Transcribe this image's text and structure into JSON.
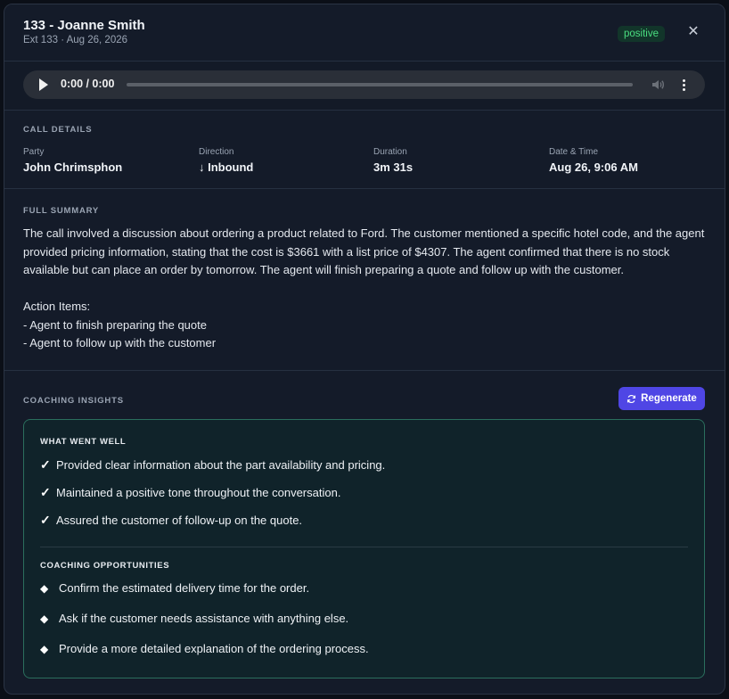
{
  "header": {
    "title": "133 - Joanne Smith",
    "subtitle": "Ext 133 · Aug 26, 2026",
    "sentiment": "positive",
    "close_glyph": "✕"
  },
  "audio": {
    "time": "0:00 / 0:00"
  },
  "details": {
    "label": "Call Details",
    "party_label": "Party",
    "party": "John Chrimsphon",
    "direction_label": "Direction",
    "direction": "↓ Inbound",
    "duration_label": "Duration",
    "duration": "3m 31s",
    "datetime_label": "Date & Time",
    "datetime": "Aug 26, 9:06 AM"
  },
  "summary": {
    "label": "Full Summary",
    "text": "The call involved a discussion about ordering a product related to Ford. The customer mentioned a specific hotel code, and the agent provided pricing information, stating that the cost is $3661 with a list price of $4307. The agent confirmed that there is no stock available but can place an order by tomorrow. The agent will finish preparing a quote and follow up with the customer.\n\nAction Items:\n- Agent to finish preparing the quote\n- Agent to follow up with the customer"
  },
  "coaching": {
    "label": "Coaching Insights",
    "regenerate_label": "Regenerate",
    "went_well_label": "What Went Well",
    "went_well": [
      "Provided clear information about the part availability and pricing.",
      "Maintained a positive tone throughout the conversation.",
      "Assured the customer of follow-up on the quote."
    ],
    "opportunities_label": "Coaching Opportunities",
    "opportunities": [
      "Confirm the estimated delivery time for the order.",
      "Ask if the customer needs assistance with anything else.",
      "Provide a more detailed explanation of the ordering process."
    ]
  },
  "colors": {
    "accent": "#4f46e5",
    "positive": "#4ade80",
    "card_border": "#2b6e5d"
  }
}
